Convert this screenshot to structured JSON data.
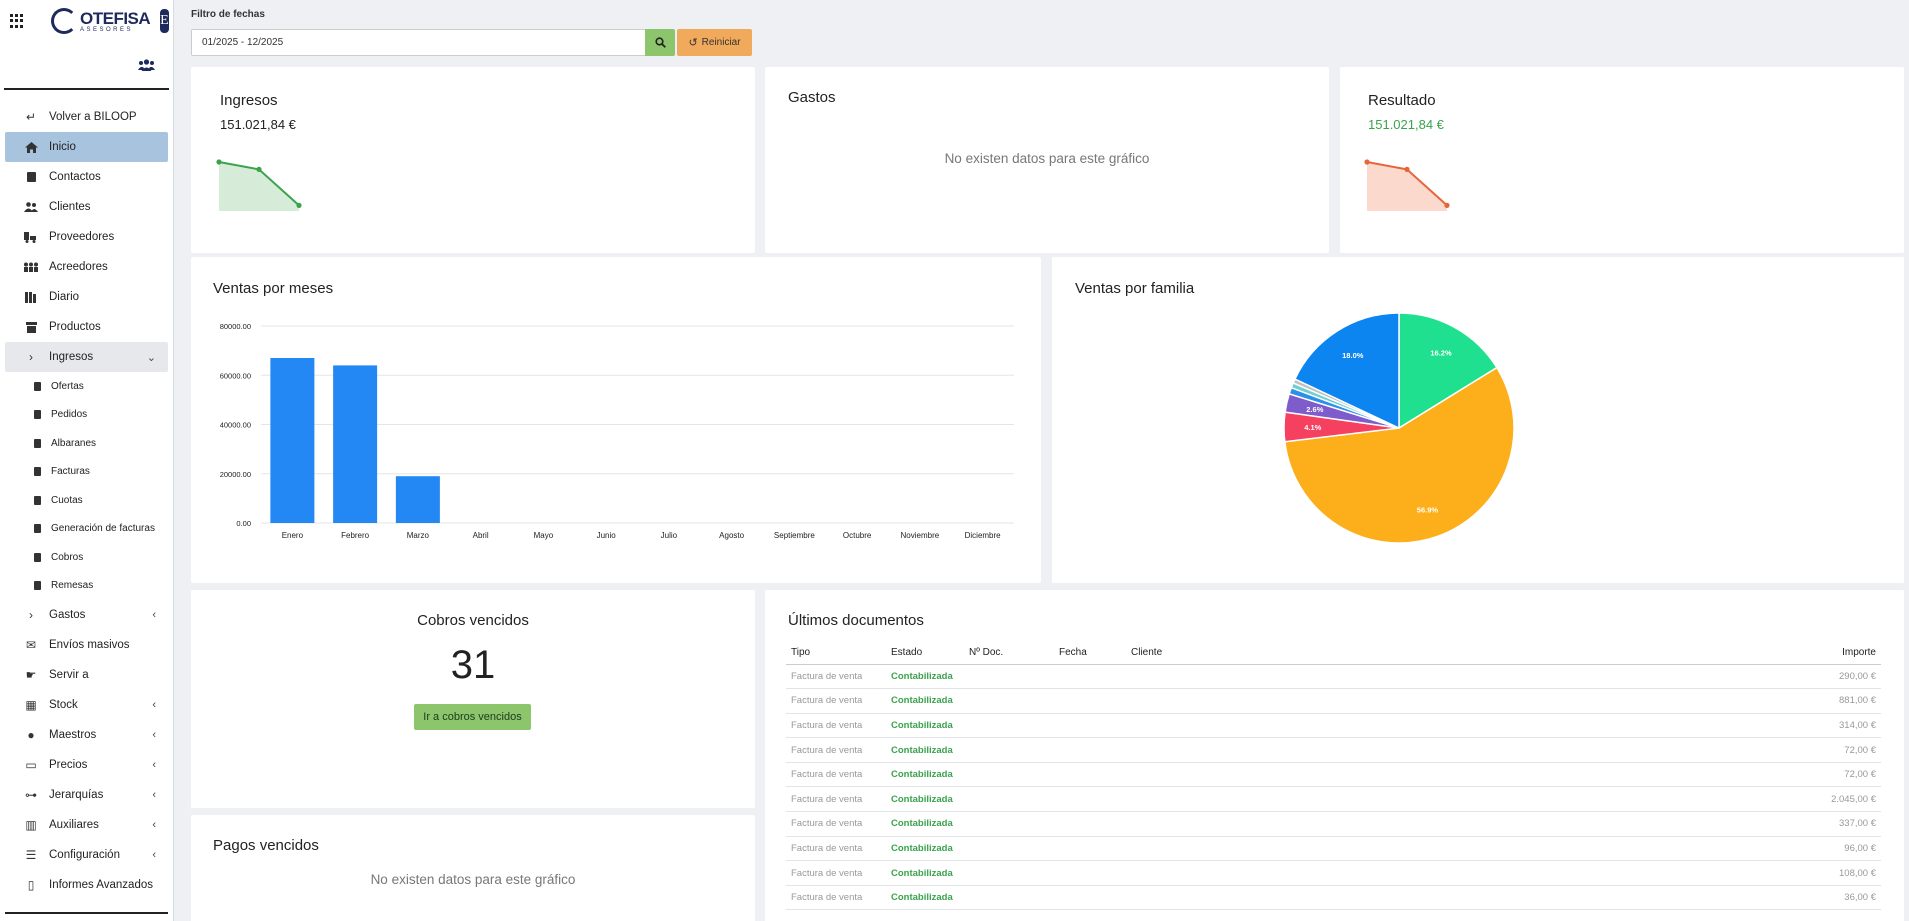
{
  "brand": {
    "logo_main": "OTEFISA",
    "logo_sub": "ASESORES",
    "badge": "E"
  },
  "filter": {
    "label": "Filtro de fechas",
    "value": "01/2025 - 12/2025",
    "reset_label": "Reiniciar"
  },
  "sidebar": {
    "back": "Volver a BILOOP",
    "items": [
      {
        "label": "Inicio",
        "icon": "home-icon"
      },
      {
        "label": "Contactos",
        "icon": "contact-card-icon"
      },
      {
        "label": "Clientes",
        "icon": "users-icon"
      },
      {
        "label": "Proveedores",
        "icon": "truck-icon"
      },
      {
        "label": "Acreedores",
        "icon": "group-icon"
      },
      {
        "label": "Diario",
        "icon": "book-icon"
      },
      {
        "label": "Productos",
        "icon": "box-icon"
      },
      {
        "label": "Ingresos",
        "icon": "chevron-right-icon"
      }
    ],
    "ingresos_sub": [
      "Ofertas",
      "Pedidos",
      "Albaranes",
      "Facturas",
      "Cuotas",
      "Generación de facturas",
      "Cobros",
      "Remesas"
    ],
    "items_after": [
      {
        "label": "Gastos",
        "icon": "chevron-right-icon",
        "arrow": true
      },
      {
        "label": "Envíos masivos",
        "icon": "mail-icon",
        "arrow": false
      },
      {
        "label": "Servir a",
        "icon": "hand-icon",
        "arrow": false
      },
      {
        "label": "Stock",
        "icon": "warehouse-icon",
        "arrow": true
      },
      {
        "label": "Maestros",
        "icon": "user-icon",
        "arrow": true
      },
      {
        "label": "Precios",
        "icon": "money-icon",
        "arrow": true
      },
      {
        "label": "Jerarquías",
        "icon": "sitemap-icon",
        "arrow": true
      },
      {
        "label": "Auxiliares",
        "icon": "building-icon",
        "arrow": true
      },
      {
        "label": "Configuración",
        "icon": "sliders-icon",
        "arrow": true
      },
      {
        "label": "Informes Avanzados",
        "icon": "file-icon",
        "arrow": false
      }
    ]
  },
  "ingresos": {
    "title": "Ingresos",
    "value": "151.021,84 €",
    "color": "#3aa34c"
  },
  "gastos": {
    "title": "Gastos",
    "no_data": "No existen datos para este gráfico"
  },
  "resultado": {
    "title": "Resultado",
    "value": "151.021,84 €",
    "color": "#e5663a"
  },
  "ventas_meses": {
    "title": "Ventas por meses"
  },
  "ventas_familia": {
    "title": "Ventas por familia"
  },
  "cobros": {
    "title": "Cobros vencidos",
    "count": "31",
    "button": "Ir a cobros vencidos"
  },
  "pagos": {
    "title": "Pagos vencidos",
    "no_data": "No existen datos para este gráfico"
  },
  "documentos": {
    "title": "Últimos documentos",
    "headers": [
      "Tipo",
      "Estado",
      "Nº Doc.",
      "Fecha",
      "Cliente",
      "Importe"
    ],
    "rows": [
      {
        "tipo": "Factura de venta",
        "estado": "Contabilizada",
        "importe": "290,00 €"
      },
      {
        "tipo": "Factura de venta",
        "estado": "Contabilizada",
        "importe": "881,00 €"
      },
      {
        "tipo": "Factura de venta",
        "estado": "Contabilizada",
        "importe": "314,00 €"
      },
      {
        "tipo": "Factura de venta",
        "estado": "Contabilizada",
        "importe": "72,00 €"
      },
      {
        "tipo": "Factura de venta",
        "estado": "Contabilizada",
        "importe": "72,00 €"
      },
      {
        "tipo": "Factura de venta",
        "estado": "Contabilizada",
        "importe": "2.045,00 €"
      },
      {
        "tipo": "Factura de venta",
        "estado": "Contabilizada",
        "importe": "337,00 €"
      },
      {
        "tipo": "Factura de venta",
        "estado": "Contabilizada",
        "importe": "96,00 €"
      },
      {
        "tipo": "Factura de venta",
        "estado": "Contabilizada",
        "importe": "108,00 €"
      },
      {
        "tipo": "Factura de venta",
        "estado": "Contabilizada",
        "importe": "36,00 €"
      }
    ]
  },
  "chart_data": [
    {
      "type": "bar",
      "title": "Ventas por meses",
      "categories": [
        "Enero",
        "Febrero",
        "Marzo",
        "Abril",
        "Mayo",
        "Junio",
        "Julio",
        "Agosto",
        "Septiembre",
        "Octubre",
        "Noviembre",
        "Diciembre"
      ],
      "values": [
        67000,
        64000,
        19000,
        0,
        0,
        0,
        0,
        0,
        0,
        0,
        0,
        0
      ],
      "ylim": [
        0,
        80000
      ],
      "yticks": [
        "0.00",
        "20000.00",
        "40000.00",
        "60000.00",
        "80000.00"
      ],
      "color": "#2388f3",
      "grid": true
    },
    {
      "type": "pie",
      "title": "Ventas por familia",
      "values": [
        16.2,
        56.9,
        4.1,
        2.6,
        0.9,
        0.7,
        0.6,
        18.0
      ],
      "labels": [
        "16.2%",
        "56.9%",
        "4.1%",
        "2.6%",
        "",
        "",
        "",
        "18.0%"
      ],
      "colors": [
        "#1fe08e",
        "#fdaf1b",
        "#f5405f",
        "#7f5ccc",
        "#2a90e8",
        "#6fcfcf",
        "#c0c0c0",
        "#0d85f0"
      ]
    },
    {
      "type": "area",
      "name": "ingresos-sparkline",
      "values": [
        67000,
        64000,
        19000
      ],
      "color": "#3aa34c"
    },
    {
      "type": "area",
      "name": "resultado-sparkline",
      "values": [
        67000,
        64000,
        19000
      ],
      "color": "#e5663a"
    }
  ]
}
